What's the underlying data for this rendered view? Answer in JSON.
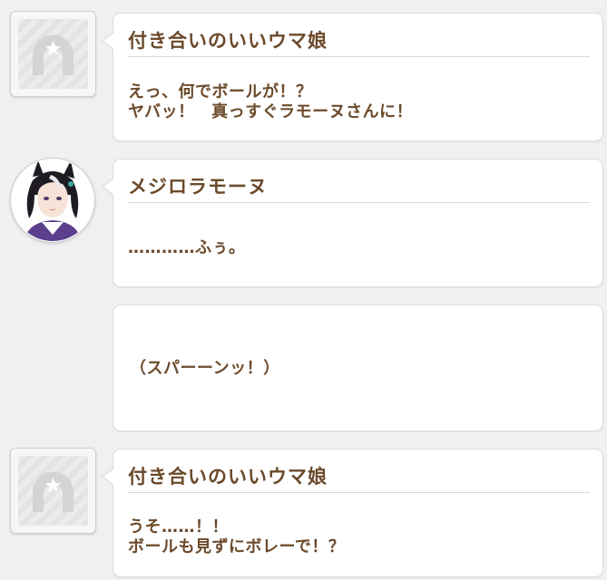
{
  "messages": [
    {
      "speaker": "付き合いのいいウマ娘",
      "text": "えっ、何でボールが！？\nヤバッ！　真っすぐラモーヌさんに！",
      "avatar": "horseshoe-placeholder-icon"
    },
    {
      "speaker": "メジロラモーヌ",
      "text": "…………ふぅ。",
      "avatar": "mejiro-ramonu-portrait"
    },
    {
      "speaker": "",
      "text": "（スパーーンッ！）",
      "avatar": ""
    },
    {
      "speaker": "付き合いのいいウマ娘",
      "text": "うそ……！！\nボールも見ずにボレーで！？",
      "avatar": "horseshoe-placeholder-icon"
    }
  ],
  "colors": {
    "text_brown": "#6b4a2b",
    "background": "#f0f0f0",
    "bubble": "#ffffff"
  }
}
